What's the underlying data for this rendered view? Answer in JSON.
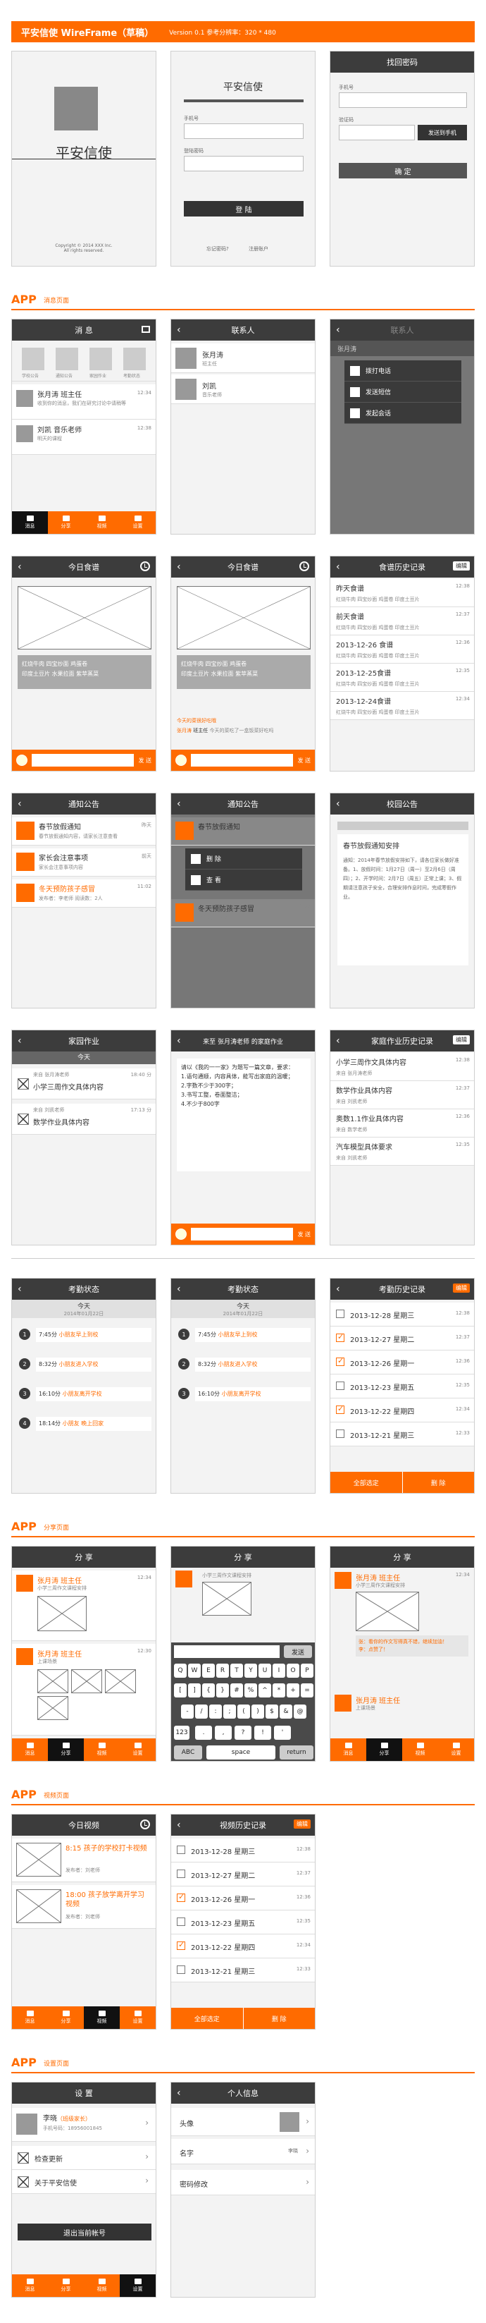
{
  "header": {
    "title": "平安信使 WireFrame（草稿）",
    "version": "Version 0.1 参考分辨率：320 * 480"
  },
  "sections": [
    {
      "label": "APP",
      "sub": "消息页面"
    },
    {
      "label": "APP",
      "sub": "分享页面"
    },
    {
      "label": "APP",
      "sub": "视频页面"
    },
    {
      "label": "APP",
      "sub": "设置页面"
    }
  ],
  "splash": {
    "name": "平安信使",
    "copyright": "Copyright © 2014 XXX Inc.\nAll rights reserved."
  },
  "login": {
    "title": "平安信使",
    "phone_label": "手机号",
    "pwd_label": "登陆密码",
    "login_btn": "登 陆",
    "forgot": "忘记密码?",
    "register": "注册账户"
  },
  "findpwd": {
    "title": "找回密码",
    "phone_label": "手机号",
    "code_label": "验证码",
    "send_btn": "发送到手机",
    "ok_btn": "确 定"
  },
  "messages": {
    "title": "消 息",
    "icons": [
      "学校公告",
      "通知公告",
      "家园作业",
      "考勤状态"
    ],
    "items": [
      {
        "name": "张月涛 班主任",
        "sub": "收到你的消息，我们在研究讨论中请稍等",
        "time": "12:34"
      },
      {
        "name": "刘凯 音乐老师",
        "sub": "明天的课程",
        "time": "12:38"
      }
    ],
    "tabs": [
      "消息",
      "分享",
      "视频",
      "设置"
    ]
  },
  "contacts": {
    "title": "联系人",
    "items": [
      {
        "name": "张月涛",
        "sub": "班主任"
      },
      {
        "name": "刘凯",
        "sub": "音乐老师"
      }
    ]
  },
  "contact_menu": {
    "title": "联系人",
    "name": "张月涛",
    "options": [
      "拨打电话",
      "发送短信",
      "发起会话"
    ]
  },
  "recipe": {
    "title": "今日食谱",
    "text": "红烧牛肉  四宝炒面  鸡蛋卷\n印度土豆片  水果拉面  紫苹蒸菜",
    "send": "发 送"
  },
  "recipe2": {
    "title": "今日食谱",
    "text": "红烧牛肉  四宝炒面  鸡蛋卷\n印度土豆片  水果拉面  紫苹蒸菜",
    "tip1": "今天的菜很好吃哦",
    "reply_name": "张月涛",
    "reply_tag": "班主任",
    "reply_sub": "今天的菜吃了一盒饭菜好吃吗",
    "send": "发 送"
  },
  "recipe_hist": {
    "title": "食谱历史记录",
    "edit": "编辑",
    "items": [
      {
        "t": "昨天食谱",
        "s": "红烧牛肉  四宝炒面  鸡蛋卷 印度土豆片",
        "d": "12:38"
      },
      {
        "t": "前天食谱",
        "s": "红烧牛肉  四宝炒面  鸡蛋卷 印度土豆片",
        "d": "12:37"
      },
      {
        "t": "2013-12-26 食谱",
        "s": "红烧牛肉  四宝炒面  鸡蛋卷 印度土豆片",
        "d": "12:36"
      },
      {
        "t": "2013-12-25食谱",
        "s": "红烧牛肉  四宝炒面  鸡蛋卷 印度土豆片",
        "d": "12:35"
      },
      {
        "t": "2013-12-24食谱",
        "s": "红烧牛肉  四宝炒面  鸡蛋卷 印度土豆片",
        "d": "12:34"
      }
    ]
  },
  "notice": {
    "title": "通知公告",
    "items": [
      {
        "t": "春节放假通知",
        "s": "春节放假通知内容，请家长注意查看",
        "d": "昨天"
      },
      {
        "t": "家长会注意事项",
        "s": "家长会注意事项内容",
        "d": "前天"
      },
      {
        "t": "冬天预防孩子感冒",
        "s": "发布者：李老师 阅读数：2人",
        "d": "11:02"
      }
    ]
  },
  "notice2": {
    "title": "通知公告",
    "items": [
      {
        "t": "春节放假通知",
        "d": "昨天"
      },
      {
        "t": "家长会注意事项",
        "d": "前天"
      },
      {
        "t": "冬天预防孩子感冒",
        "s": "发布者：李老师",
        "d": "11:02"
      }
    ],
    "menu": [
      "删 除",
      "查 看"
    ]
  },
  "school_notice": {
    "title": "校园公告",
    "head": "春节放假通知安排",
    "body": "通知：2014年春节放假安排如下，请各位家长做好准备。1、放假时间：1月27日（周一）至2月6日（周四）；2、开学时间：2月7日（周五）正常上课；3、假期请注意孩子安全，合理安排作息时间，完成寒假作业。"
  },
  "homework": {
    "title": "家园作业",
    "today": "今天",
    "items": [
      {
        "from": "来自 张月涛老师",
        "t": "小学三周作文具体内容",
        "d": "18:40 分"
      },
      {
        "from": "来自 刘凯老师",
        "t": "数学作业具体内容",
        "d": "17:13 分"
      }
    ]
  },
  "homework_detail": {
    "title": "来至 张月涛老师 的家庭作业",
    "body": "请以《我的一一家》为题写一篇文章，要求：\n1.语句通顺，内容具体，能写出家庭的温暖；\n2.字数不少于300字；\n3.书写工整，卷面整洁；\n4.不少于800字",
    "send": "发 送"
  },
  "homework_hist": {
    "title": "家庭作业历史记录",
    "edit": "编辑",
    "items": [
      {
        "t": "小学三周作文具体内容",
        "s": "来自 张月涛老师",
        "d": "12:38"
      },
      {
        "t": "数学作业具体内容",
        "s": "来自 刘凯老师",
        "d": "12:37"
      },
      {
        "t": "奥数1.1作业具体内容",
        "s": "来自 数学老师",
        "d": "12:36"
      },
      {
        "t": "汽车模型具体要求",
        "s": "来自 刘凯老师",
        "d": "12:35"
      }
    ]
  },
  "attendance": {
    "title": "考勤状态",
    "today": "今天",
    "date": "2014年01月22日",
    "items": [
      {
        "n": "1",
        "time": "7:45分",
        "txt": "小朋友早上到校"
      },
      {
        "n": "2",
        "time": "8:32分",
        "txt": "小朋友进入学校"
      },
      {
        "n": "3",
        "time": "16:10分",
        "txt": "小朋友离开学校"
      },
      {
        "n": "4",
        "time": "18:14分",
        "txt": "小朋友 晚上回家"
      }
    ]
  },
  "attendance2": {
    "title": "考勤状态",
    "today": "今天",
    "date": "2014年01月22日",
    "items": [
      {
        "n": "1",
        "time": "7:45分",
        "txt": "小朋友早上到校"
      },
      {
        "n": "2",
        "time": "8:32分",
        "txt": "小朋友进入学校"
      },
      {
        "n": "3",
        "time": "16:10分",
        "txt": "小朋友离开学校"
      }
    ]
  },
  "attend_hist": {
    "title": "考勤历史记录",
    "edit": "编辑",
    "items": [
      {
        "t": "2013-12-28 星期三",
        "d": "12:38",
        "on": false
      },
      {
        "t": "2013-12-27 星期二",
        "d": "12:37",
        "on": true
      },
      {
        "t": "2013-12-26 星期一",
        "d": "12:36",
        "on": true
      },
      {
        "t": "2013-12-23 星期五",
        "d": "12:35",
        "on": false
      },
      {
        "t": "2013-12-22 星期四",
        "d": "12:34",
        "on": true
      },
      {
        "t": "2013-12-21 星期三",
        "d": "12:33",
        "on": false
      }
    ],
    "select_all": "全部选定",
    "delete": "删 除"
  },
  "share": {
    "title": "分 享",
    "posts": [
      {
        "name": "张月涛 班主任",
        "sub": "小学三周作文课程安排",
        "d": "12:34"
      },
      {
        "name": "张月涛 班主任",
        "sub": "上课场景",
        "d": "12:30"
      }
    ]
  },
  "share2": {
    "title": "分 享",
    "caption": "小学三周作文课程安排",
    "keys_row1": "QWERTYUIOP",
    "send": "发送",
    "space": "space",
    "abc": "ABC",
    "ret": "return",
    "num": "123"
  },
  "share3": {
    "title": "分 享",
    "name": "张月涛 班主任",
    "sub": "小学三周作文课程安排",
    "d": "12:34",
    "c1": "张：看你的作文写得真不错，继续加油！",
    "c2": "李：点赞了！",
    "name2": "张月涛 班主任",
    "sub2": "上课场景"
  },
  "video": {
    "title": "今日视频",
    "edit": "",
    "items": [
      {
        "t": "8:15 孩子的学校打卡视频",
        "s": "发布者：刘老师",
        "d": ""
      },
      {
        "t": "18:00 孩子放学离开学习视频",
        "s": "发布者：刘老师",
        "d": ""
      }
    ]
  },
  "video_hist": {
    "title": "视频历史记录",
    "edit": "编辑",
    "items": [
      {
        "t": "2013-12-28 星期三",
        "d": "12:38",
        "on": false
      },
      {
        "t": "2013-12-27 星期二",
        "d": "12:37",
        "on": false
      },
      {
        "t": "2013-12-26 星期一",
        "d": "12:36",
        "on": true
      },
      {
        "t": "2013-12-23 星期五",
        "d": "12:35",
        "on": false
      },
      {
        "t": "2013-12-22 星期四",
        "d": "12:34",
        "on": true
      },
      {
        "t": "2013-12-21 星期三",
        "d": "12:33",
        "on": false
      }
    ],
    "select_all": "全部选定",
    "delete": "删 除"
  },
  "settings": {
    "title": "设 置",
    "user": "李晓",
    "role": "（班级家长）",
    "phone": "手机号码：18956001845",
    "update": "检查更新",
    "about": "关于平安信使",
    "logout": "退出当前帐号"
  },
  "profile": {
    "title": "个人信息",
    "avatar": "头像",
    "name_label": "名字",
    "name_val": "李晓",
    "pwd": "密码修改"
  }
}
